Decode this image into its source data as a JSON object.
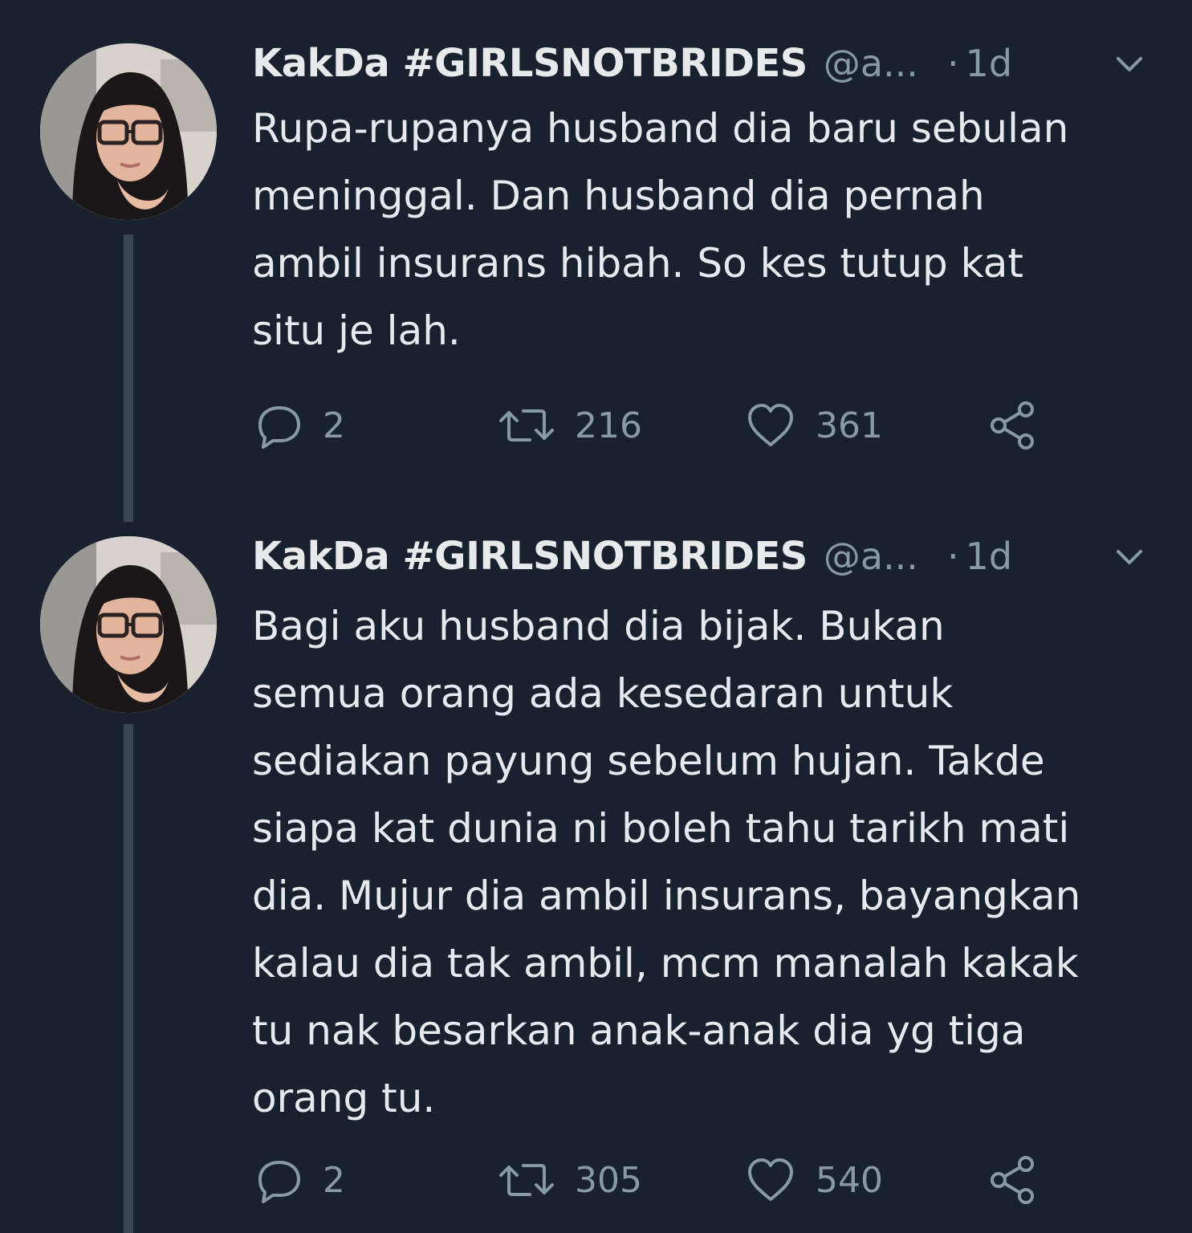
{
  "colors": {
    "background": "#18212d",
    "text": "#e6eaee",
    "muted": "#8899a6",
    "thread_line": "#3a4654"
  },
  "tweets": [
    {
      "display_name": "KakDa #GIRLSNOTBRIDES",
      "handle": "@a...",
      "separator": "·",
      "time": "1d",
      "text": "Rupa-rupanya husband dia baru sebulan\nmeninggal. Dan husband dia pernah\nambil insurans hibah. So kes tutup kat\nsitu je lah.",
      "replies": "2",
      "retweets": "216",
      "likes": "361",
      "icons": {
        "reply": "reply-icon",
        "retweet": "retweet-icon",
        "like": "heart-icon",
        "share": "share-icon",
        "menu": "chevron-down-icon"
      }
    },
    {
      "display_name": "KakDa #GIRLSNOTBRIDES",
      "handle": "@a...",
      "separator": "·",
      "time": "1d",
      "text": "Bagi aku husband dia bijak. Bukan\nsemua orang ada kesedaran untuk\nsediakan payung sebelum hujan. Takde\nsiapa kat dunia ni boleh tahu tarikh mati\ndia. Mujur dia ambil insurans, bayangkan\nkalau dia tak ambil, mcm manalah kakak\ntu nak besarkan anak-anak dia yg tiga\norang tu.",
      "replies": "2",
      "retweets": "305",
      "likes": "540",
      "icons": {
        "reply": "reply-icon",
        "retweet": "retweet-icon",
        "like": "heart-icon",
        "share": "share-icon",
        "menu": "chevron-down-icon"
      }
    }
  ]
}
